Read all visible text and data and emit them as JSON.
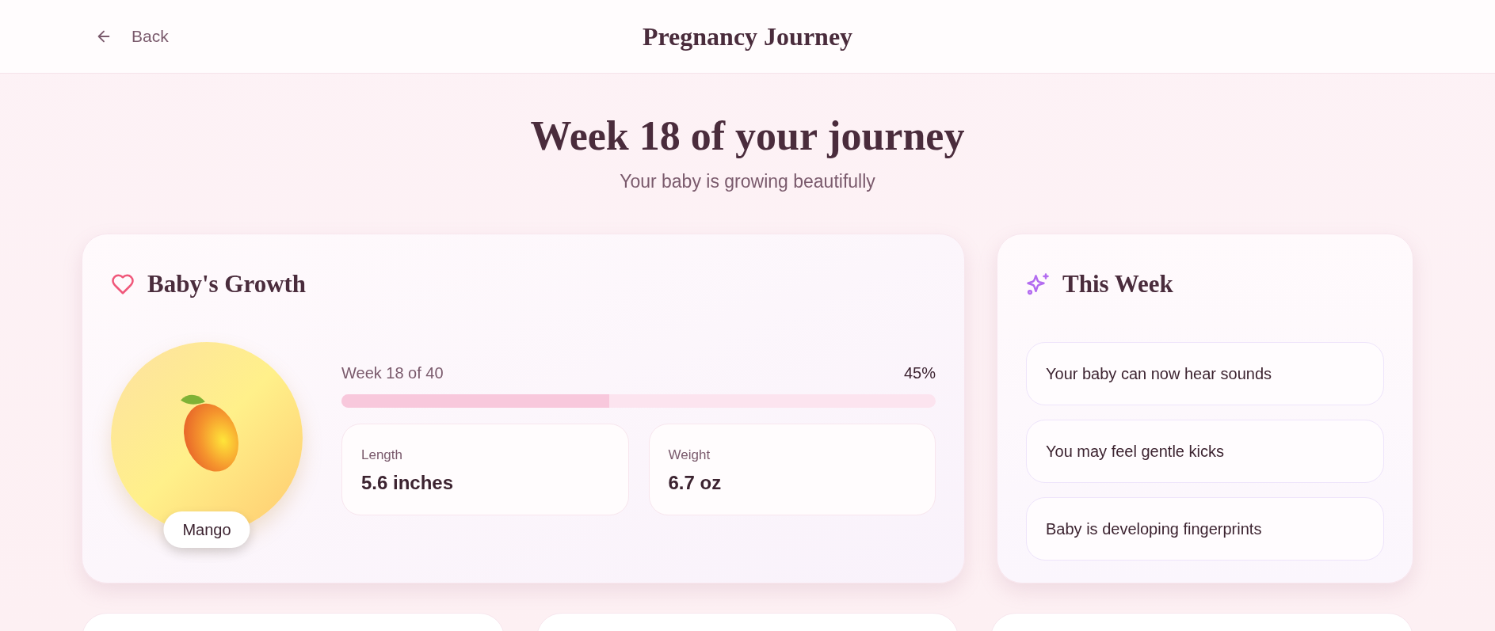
{
  "header": {
    "back_label": "Back",
    "title": "Pregnancy Journey"
  },
  "hero": {
    "heading": "Week 18 of your journey",
    "subtitle": "Your baby is growing beautifully"
  },
  "growth": {
    "title": "Baby's Growth",
    "fruit_label": "Mango",
    "progress": {
      "label": "Week 18 of 40",
      "reading": "45%",
      "level": 0.45
    },
    "stats": [
      {
        "label": "Length",
        "value": "5.6 inches"
      },
      {
        "label": "Weight",
        "value": "6.7 oz"
      }
    ]
  },
  "this_week": {
    "title": "This Week",
    "items": [
      "Your baby can now hear sounds",
      "You may feel gentle kicks",
      "Baby is developing fingerprints"
    ]
  }
}
